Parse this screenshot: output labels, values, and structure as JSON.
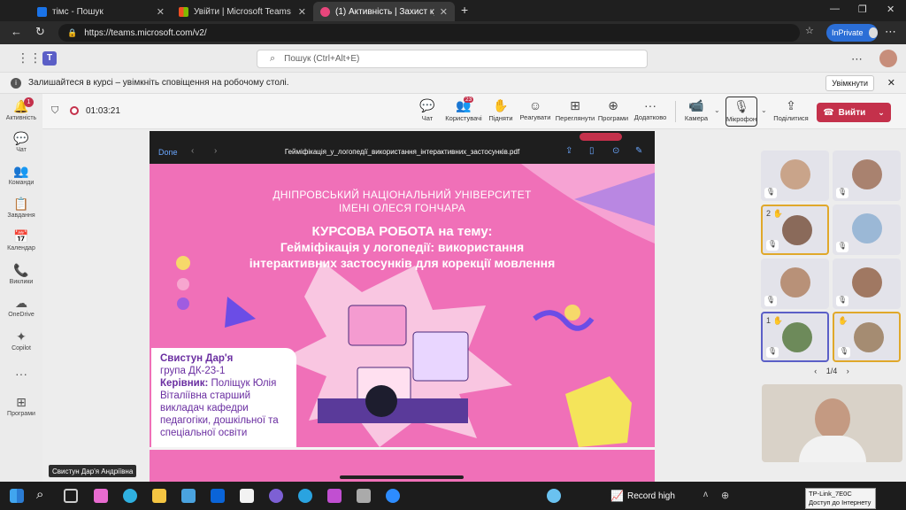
{
  "browser": {
    "tabs": [
      {
        "title": "тімс - Пошук",
        "color": "#1a73e8"
      },
      {
        "title": "Увійти | Microsoft Teams",
        "color": "#f25022"
      },
      {
        "title": "(1) Активність | Захист курс",
        "color": "#e8467c"
      }
    ],
    "new_tab": "+",
    "url": "https://teams.microsoft.com/v2/",
    "inprivate": "InPrivate"
  },
  "teams": {
    "search_placeholder": "Пошук (Ctrl+Alt+E)",
    "banner_text": "Залишайтеся в курсі – увімкніть сповіщення на робочому столі.",
    "banner_button": "Увімкнути",
    "rail": [
      {
        "label": "Активність",
        "icon": "bell-icon",
        "glyph": "🔔",
        "badge": "1"
      },
      {
        "label": "Чат",
        "icon": "chat-icon",
        "glyph": "💬"
      },
      {
        "label": "Команди",
        "icon": "teams-icon",
        "glyph": "👥"
      },
      {
        "label": "Завдання",
        "icon": "assignments-icon",
        "glyph": "📋"
      },
      {
        "label": "Календар",
        "icon": "calendar-icon",
        "glyph": "📅"
      },
      {
        "label": "Виклики",
        "icon": "phone-icon",
        "glyph": "📞"
      },
      {
        "label": "OneDrive",
        "icon": "cloud-icon",
        "glyph": "☁"
      },
      {
        "label": "Copilot",
        "icon": "copilot-icon",
        "glyph": "✦"
      },
      {
        "label": "",
        "icon": "more-icon",
        "glyph": "···"
      },
      {
        "label": "Програми",
        "icon": "apps-icon",
        "glyph": "⊞"
      }
    ]
  },
  "meeting": {
    "timer": "01:03:21",
    "toolbar": [
      {
        "label": "Чат",
        "icon": "chat-icon",
        "glyph": "💬"
      },
      {
        "label": "Користувачі",
        "icon": "people-icon",
        "glyph": "👥",
        "badge": "23"
      },
      {
        "label": "Підняти",
        "icon": "raise-hand-icon",
        "glyph": "✋"
      },
      {
        "label": "Реагувати",
        "icon": "emoji-icon",
        "glyph": "☺"
      },
      {
        "label": "Переглянути",
        "icon": "view-icon",
        "glyph": "⊞"
      },
      {
        "label": "Програми",
        "icon": "add-apps-icon",
        "glyph": "⊕"
      },
      {
        "label": "Додатково",
        "icon": "more-icon",
        "glyph": "···"
      },
      {
        "label": "Камера",
        "icon": "camera-icon",
        "glyph": "📹"
      },
      {
        "label": "Мікрофон",
        "icon": "microphone-icon",
        "glyph": "🎙"
      },
      {
        "label": "Поділитися",
        "icon": "share-icon",
        "glyph": "⇪"
      }
    ],
    "leave": "Вийти",
    "pager": "1/4",
    "presenter_name": "Свистун Дар'я Андріївна",
    "hand_numbers": [
      "2",
      "1"
    ]
  },
  "pdf": {
    "done": "Done",
    "filename": "Гейміфікація_у_логопедії_використання_інтерактивних_застосунків.pdf"
  },
  "slide": {
    "university_line1": "ДНІПРОВСЬКИЙ НАЦІОНАЛЬНИЙ УНІВЕРСИТЕТ",
    "university_line2": "ІМЕНІ ОЛЕСЯ ГОНЧАРА",
    "heading": "КУРСОВА РОБОТА на тему:",
    "topic_line1": "Гейміфікація у логопедії: використання",
    "topic_line2": "інтерактивних застосунків для корекції мовлення",
    "author": "Свистун Дар'я",
    "group": "група ДК-23-1",
    "supervisor_label": "Керівник:",
    "supervisor_name": " Поліщук Юлія",
    "supervisor_lines": [
      "Віталіївна старший",
      "викладач кафедри",
      "педагогіки, дошкільної та",
      "спеціальної освіти"
    ]
  },
  "taskbar": {
    "record_label": "Record high",
    "wifi_tooltip_line1": "TP-Link_7E0C",
    "wifi_tooltip_line2": "Доступ до Інтернету"
  },
  "colors": {
    "slide_pink": "#f070b8",
    "slide_purple": "#6a2ea1",
    "leave_red": "#c4314b",
    "accent_blue": "#5b5fc7",
    "raise_hand_gold": "#e0a82a"
  }
}
